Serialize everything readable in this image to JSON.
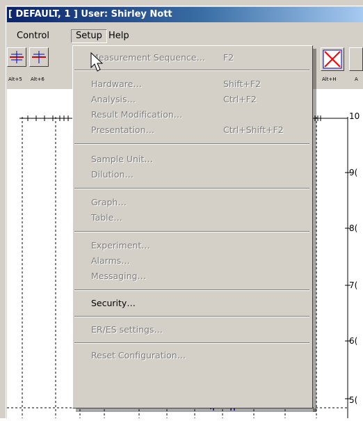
{
  "window": {
    "title": "[ DEFAULT, 1 ] User: Shirley Nott"
  },
  "menubar": {
    "items": [
      "Control",
      "Setup",
      "Help"
    ],
    "active": "Setup"
  },
  "toolbar": {
    "buttons": [
      {
        "label": "Alt+5",
        "icon": "axis-icon"
      },
      {
        "label": "Alt+6",
        "icon": "axis-icon"
      },
      {
        "label": "Alt+H",
        "icon": "red-x-icon"
      },
      {
        "label": "A",
        "icon": "partial-button"
      }
    ]
  },
  "setup_menu": {
    "groups": [
      [
        {
          "label": "Measurement Sequence…",
          "shortcut": "F2",
          "enabled": false
        }
      ],
      [
        {
          "label": "Hardware…",
          "shortcut": "Shift+F2",
          "enabled": false
        },
        {
          "label": "Analysis…",
          "shortcut": "Ctrl+F2",
          "enabled": false
        },
        {
          "label": "Result Modification…",
          "shortcut": "",
          "enabled": false
        },
        {
          "label": "Presentation…",
          "shortcut": "Ctrl+Shift+F2",
          "enabled": false
        }
      ],
      [
        {
          "label": "Sample Unit…",
          "shortcut": "",
          "enabled": false
        },
        {
          "label": "Dilution…",
          "shortcut": "",
          "enabled": false
        }
      ],
      [
        {
          "label": "Graph…",
          "shortcut": "",
          "enabled": false
        },
        {
          "label": "Table…",
          "shortcut": "",
          "enabled": false
        }
      ],
      [
        {
          "label": "Experiment…",
          "shortcut": "",
          "enabled": false
        },
        {
          "label": "Alarms…",
          "shortcut": "",
          "enabled": false
        },
        {
          "label": "Messaging…",
          "shortcut": "",
          "enabled": false
        }
      ],
      [
        {
          "label": "Security…",
          "shortcut": "",
          "enabled": true
        }
      ],
      [
        {
          "label": "ER/ES settings…",
          "shortcut": "",
          "enabled": false
        }
      ],
      [
        {
          "label": "Reset Configuration…",
          "shortcut": "",
          "enabled": false
        }
      ]
    ]
  },
  "chart": {
    "y_ticks": [
      "10",
      "9(",
      "8(",
      "7(",
      "6(",
      "5("
    ],
    "colors": {
      "curve": "#0000ff",
      "grid": "#000000",
      "red_x": "#ff0000"
    }
  }
}
